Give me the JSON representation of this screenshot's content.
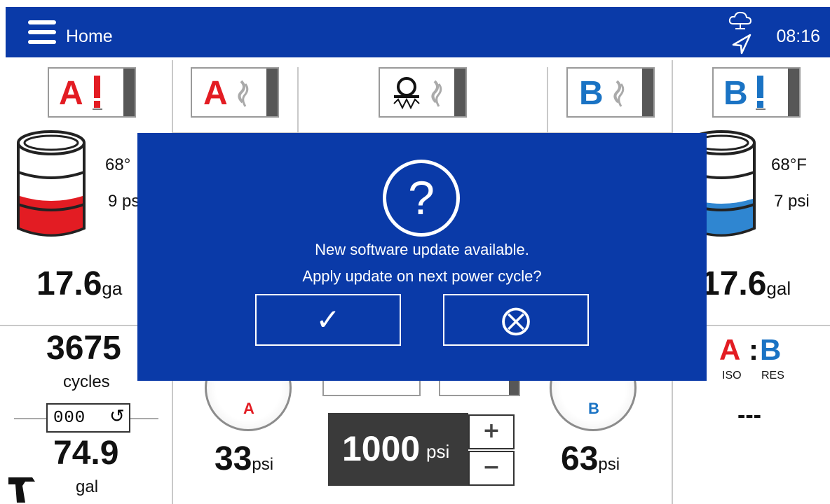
{
  "header": {
    "title": "Home",
    "time": "08:16",
    "icons": [
      "menu-icon",
      "cloud-network-icon",
      "location-arrow-icon"
    ]
  },
  "tiles": [
    {
      "name": "tank-a-level",
      "letter": "A",
      "color": "#e31c23",
      "symbol": "!"
    },
    {
      "name": "heater-a",
      "letter": "A",
      "color": "#e31c23",
      "symbol": "heat"
    },
    {
      "name": "hose-heat",
      "letter": "",
      "color": "#111111",
      "symbol": "hose-heat"
    },
    {
      "name": "heater-b",
      "letter": "B",
      "color": "#1a73c4",
      "symbol": "heat"
    },
    {
      "name": "tank-b-level",
      "letter": "B",
      "color": "#1a73c4",
      "symbol": "!"
    }
  ],
  "tank_a": {
    "temp": "68°",
    "pressure": "9 ps",
    "volume": "17.6",
    "volume_unit": "ga",
    "fill_level": 0.45,
    "fill_color": "#e31c23"
  },
  "tank_b": {
    "temp": "68°F",
    "pressure": "7 psi",
    "volume": "17.6",
    "volume_unit": "gal",
    "fill_level": 0.4,
    "fill_color": "#2f86d1"
  },
  "counter": {
    "cycles": "3675",
    "cycles_label": "cycles",
    "counter_display": "000",
    "total": "74.9",
    "total_unit": "gal"
  },
  "pressure": {
    "a_value": "33",
    "a_unit": "psi",
    "a_label": "A",
    "b_value": "63",
    "b_unit": "psi",
    "b_label": "B",
    "setpoint": "1000",
    "setpoint_unit": "psi",
    "plus": "+",
    "minus": "−"
  },
  "ratio": {
    "a": "A",
    "b": "B",
    "a_label": "ISO",
    "b_label": "RES",
    "value": "---"
  },
  "dialog": {
    "line1": "New software update available.",
    "line2": "Apply update on next power cycle?",
    "confirm": "✓",
    "cancel": "⨂"
  }
}
